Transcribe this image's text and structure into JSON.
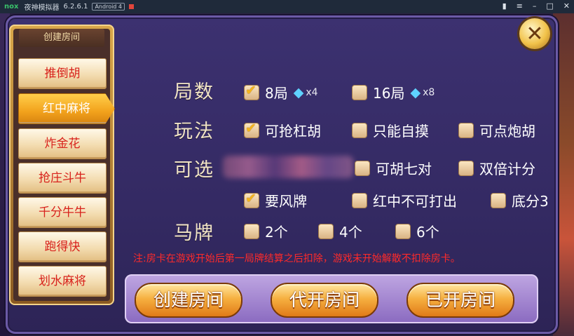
{
  "emulator": {
    "logo": "nox",
    "title": "夜神模拟器",
    "version": "6.2.6.1",
    "android": "Android 4"
  },
  "sidebar": {
    "header": "创建房间",
    "items": [
      {
        "label": "推倒胡"
      },
      {
        "label": "红中麻将"
      },
      {
        "label": "炸金花"
      },
      {
        "label": "抢庄斗牛"
      },
      {
        "label": "千分牛牛"
      },
      {
        "label": "跑得快"
      },
      {
        "label": "划水麻将"
      }
    ],
    "active_index": 1
  },
  "options": {
    "rounds": {
      "label": "局数",
      "choices": [
        {
          "text": "8局",
          "checked": true,
          "cost": "x4"
        },
        {
          "text": "16局",
          "checked": false,
          "cost": "x8"
        }
      ]
    },
    "play": {
      "label": "玩法",
      "choices": [
        {
          "text": "可抢杠胡",
          "checked": true
        },
        {
          "text": "只能自摸",
          "checked": false
        },
        {
          "text": "可点炮胡",
          "checked": false
        }
      ]
    },
    "optional": {
      "label": "可选",
      "choices": [
        {
          "text": "可胡七对",
          "checked": false
        },
        {
          "text": "双倍计分",
          "checked": false
        },
        {
          "text": "要风牌",
          "checked": true
        },
        {
          "text": "红中不可打出",
          "checked": false
        },
        {
          "text": "底分3",
          "checked": false
        }
      ]
    },
    "horse": {
      "label": "马牌",
      "choices": [
        {
          "text": "2个",
          "checked": false
        },
        {
          "text": "4个",
          "checked": false
        },
        {
          "text": "6个",
          "checked": false
        }
      ]
    }
  },
  "note": "注:房卡在游戏开始后第一局牌结算之后扣除，游戏未开始解散不扣除房卡。",
  "buttons": {
    "create": "创建房间",
    "proxy": "代开房间",
    "opened": "已开房间"
  },
  "colors": {
    "accent": "#f2a21c",
    "note": "#ff2a2a",
    "panel": "#3c3170"
  }
}
